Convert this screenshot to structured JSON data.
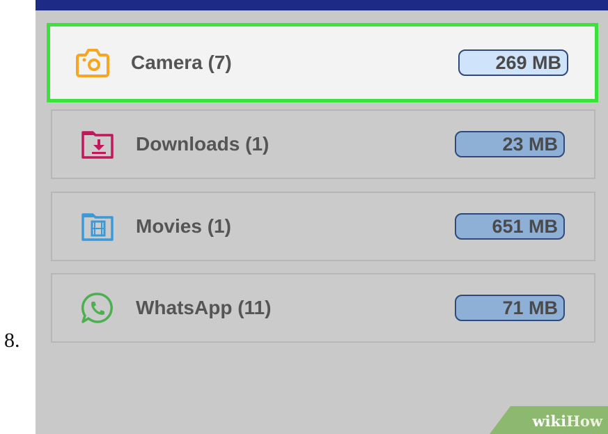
{
  "step": {
    "number": "8."
  },
  "folders": [
    {
      "name": "Camera (7)",
      "size": "269 MB",
      "icon": "camera-icon",
      "color": "#f5a623",
      "selected": true
    },
    {
      "name": "Downloads (1)",
      "size": "23 MB",
      "icon": "download-folder-icon",
      "color": "#c2185b",
      "selected": false
    },
    {
      "name": "Movies (1)",
      "size": "651 MB",
      "icon": "movie-folder-icon",
      "color": "#3a9ad9",
      "selected": false
    },
    {
      "name": "WhatsApp (11)",
      "size": "71 MB",
      "icon": "whatsapp-icon",
      "color": "#4caf50",
      "selected": false
    }
  ],
  "watermark": {
    "wiki": "wiki",
    "how": "How"
  },
  "colors": {
    "highlight": "#3be23b",
    "top_bar": "#1e2b86",
    "watermark_bg": "#8cb870"
  }
}
